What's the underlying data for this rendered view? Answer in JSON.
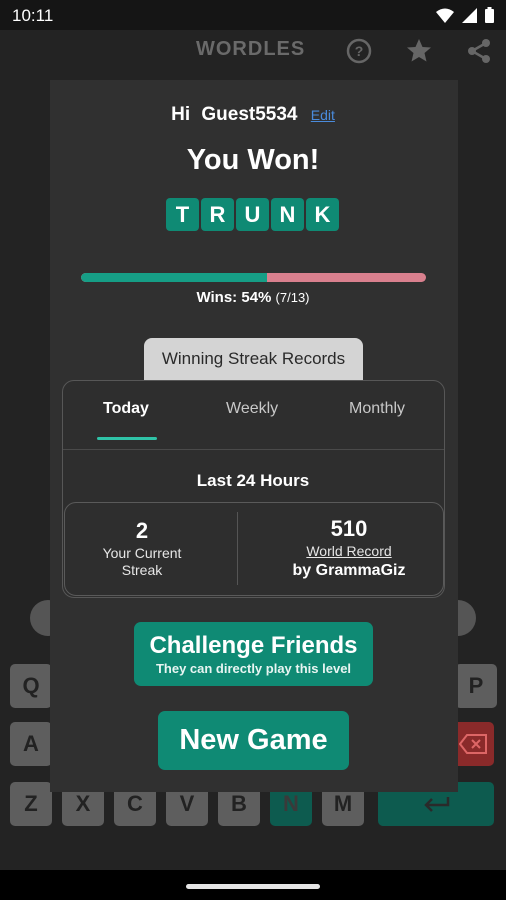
{
  "status_bar": {
    "time": "10:11"
  },
  "app": {
    "title": "WORDLES"
  },
  "keyboard": {
    "row1": [
      "Q",
      "P"
    ],
    "row2": [
      "A"
    ],
    "row3": [
      "Z",
      "X",
      "C",
      "V",
      "B",
      "N",
      "M"
    ]
  },
  "dialog": {
    "greeting": "Hi",
    "username": "Guest5534",
    "edit_label": "Edit",
    "result_title": "You Won!",
    "word_letters": [
      "T",
      "R",
      "U",
      "N",
      "K"
    ],
    "wins_label": "Wins: 54%",
    "wins_fraction": "(7/13)",
    "win_rate": 0.54,
    "streak_tab_label": "Winning Streak Records",
    "tabs": [
      "Today",
      "Weekly",
      "Monthly"
    ],
    "active_tab": "Today",
    "period_label": "Last 24 Hours",
    "current_streak_value": "2",
    "current_streak_label_line1": "Your Current",
    "current_streak_label_line2": "Streak",
    "world_record_value": "510",
    "world_record_label": "World Record",
    "world_record_holder": "by GrammaGiz",
    "challenge_button": "Challenge Friends",
    "challenge_subtext": "They can directly play this level",
    "new_game_button": "New Game"
  },
  "colors": {
    "accent_green": "#0f8a74",
    "bar_green": "#169e86",
    "bar_red": "#d9808e",
    "link_blue": "#4a8bdc",
    "tab_underline": "#2fc3a7"
  }
}
